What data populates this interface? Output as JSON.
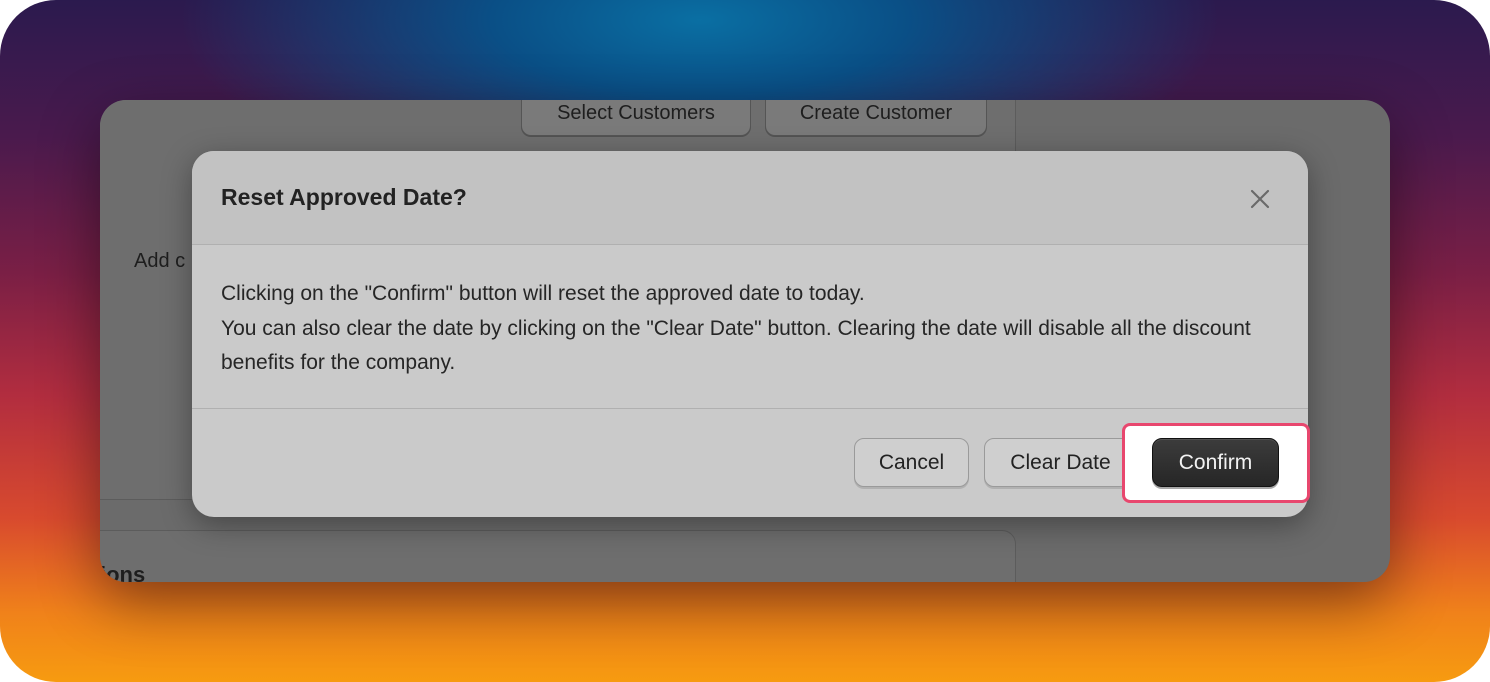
{
  "background_app": {
    "buttons": {
      "select_customers": "Select Customers",
      "create_customer": "Create Customer"
    },
    "add_text_fragment": "Add c",
    "section_title_fragment": "ions"
  },
  "modal": {
    "title": "Reset Approved Date?",
    "close_icon": "close-icon",
    "body_lines": [
      "Clicking on the \"Confirm\" button will reset the approved date to today.",
      "You can also clear the date by clicking on the \"Clear Date\" button. Clearing the date will disable all the discount benefits for the company."
    ],
    "buttons": {
      "cancel": "Cancel",
      "clear_date": "Clear Date",
      "confirm": "Confirm"
    }
  },
  "colors": {
    "highlight": "#e8476e",
    "confirm_bg": "#2b2b2b",
    "modal_bg": "#cacaca"
  }
}
